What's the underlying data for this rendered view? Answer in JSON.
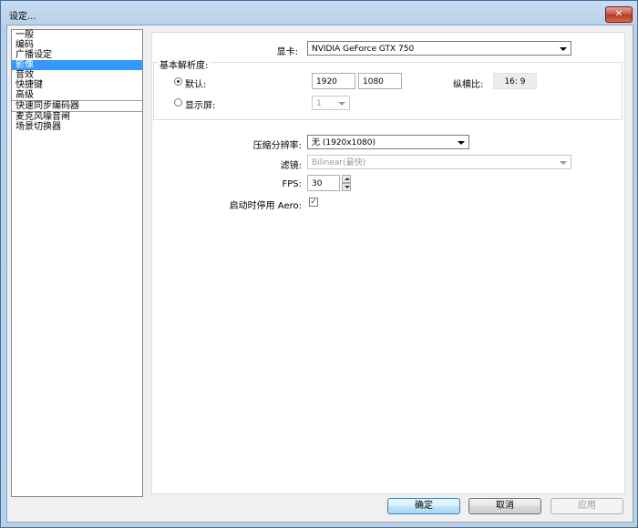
{
  "window": {
    "title": "设定...",
    "close_glyph": "✕"
  },
  "sidebar": {
    "items": [
      {
        "label": "一般"
      },
      {
        "label": "编码"
      },
      {
        "label": "广播设定"
      },
      {
        "label": "影像",
        "selected": true
      },
      {
        "label": "音效"
      },
      {
        "label": "快捷键"
      },
      {
        "label": "高级"
      },
      {
        "label": "快速同步编码器"
      },
      {
        "label": "麦克风噪音闸"
      },
      {
        "label": "场景切换器"
      }
    ]
  },
  "video": {
    "gpu_label": "显卡:",
    "gpu_value": "NVIDIA GeForce GTX 750",
    "base_resolution_title": "基本解析度:",
    "default_label": "默认:",
    "width": "1920",
    "height": "1080",
    "aspect_label": "纵横比:",
    "aspect_value": "16: 9",
    "monitor_label": "显示屏:",
    "monitor_value": "1",
    "downscale_label": "压缩分辨率:",
    "downscale_value": "无  (1920x1080)",
    "filter_label": "滤镜:",
    "filter_value": "Bilinear(最快)",
    "fps_label": "FPS:",
    "fps_value": "30",
    "aero_label": "启动时停用 Aero:",
    "aero_checked": "✓"
  },
  "buttons": {
    "ok": "确定",
    "cancel": "取消",
    "apply": "应用"
  },
  "colors": {
    "selection": "#3399ff",
    "frame": "#b9d0e9"
  }
}
